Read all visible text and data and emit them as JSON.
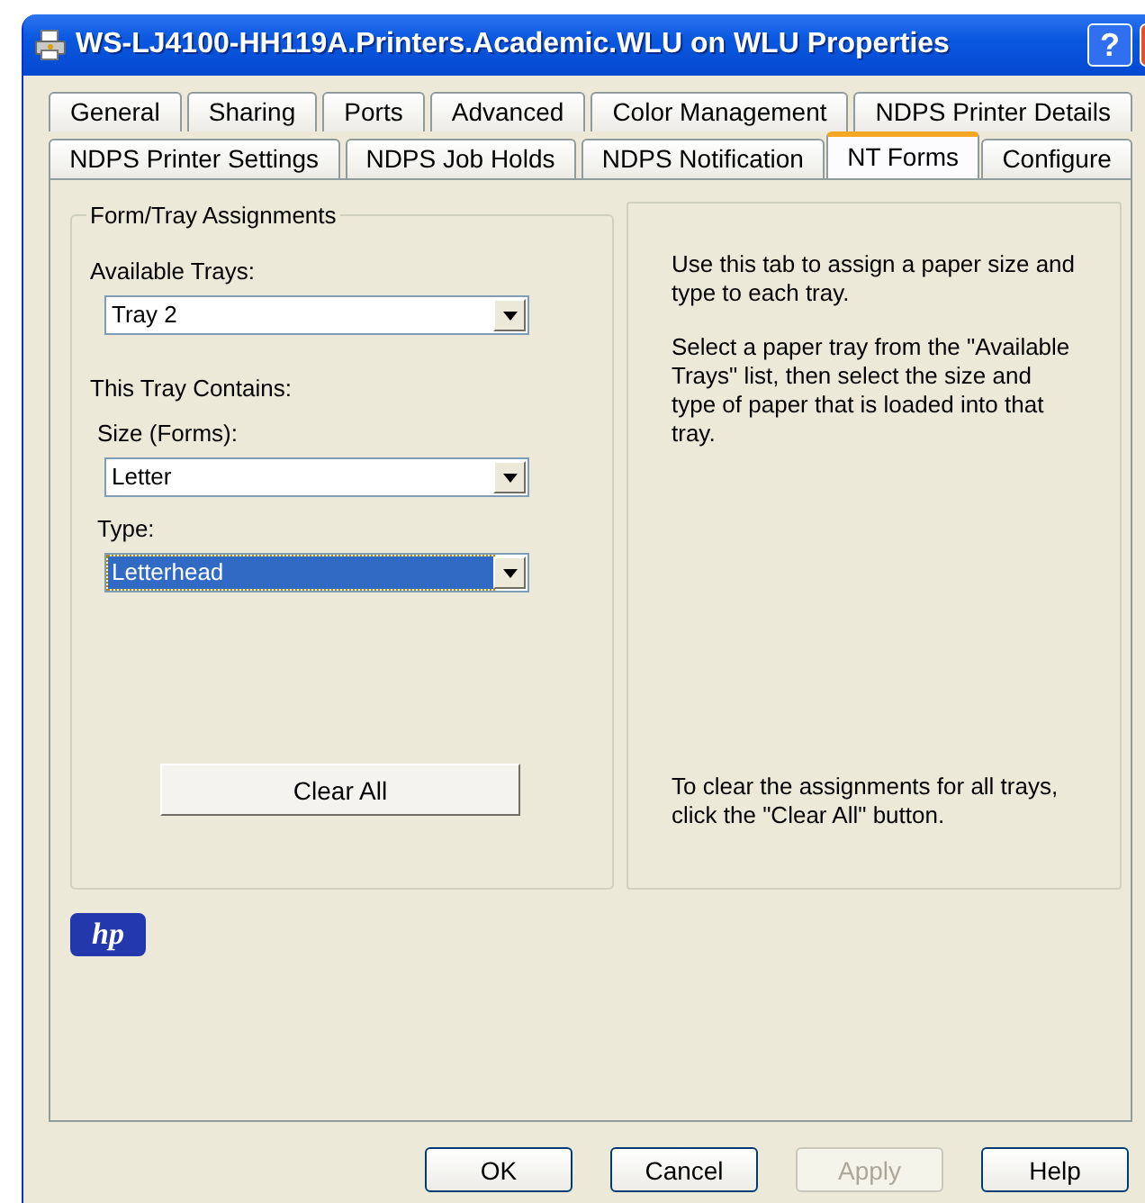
{
  "window": {
    "title": "WS-LJ4100-HH119A.Printers.Academic.WLU on WLU Properties",
    "help_button": "?"
  },
  "tab_rows": [
    {
      "tabs": [
        {
          "label": "General",
          "selected": false
        },
        {
          "label": "Sharing",
          "selected": false
        },
        {
          "label": "Ports",
          "selected": false
        },
        {
          "label": "Advanced",
          "selected": false
        },
        {
          "label": "Color Management",
          "selected": false
        },
        {
          "label": "NDPS Printer Details",
          "selected": false
        }
      ]
    },
    {
      "tabs": [
        {
          "label": "NDPS Printer Settings",
          "selected": false
        },
        {
          "label": "NDPS Job Holds",
          "selected": false
        },
        {
          "label": "NDPS Notification",
          "selected": false
        },
        {
          "label": "NT Forms",
          "selected": true
        },
        {
          "label": "Configure",
          "selected": false
        }
      ]
    }
  ],
  "group": {
    "title": "Form/Tray Assignments",
    "available_trays": {
      "label": "Available Trays:",
      "value": "Tray 2",
      "focused": false
    },
    "contains": {
      "label": "This Tray Contains:",
      "fields": [
        {
          "label": "Size (Forms):",
          "value": "Letter",
          "focused": false
        },
        {
          "label": "Type:",
          "value": "Letterhead",
          "focused": true
        }
      ]
    },
    "clear_button": "Clear All"
  },
  "help_texts": [
    "Use this tab to assign a paper size and type to each tray.",
    "Select a paper tray from the \"Available Trays\" list, then select the size and type of paper that is loaded into that tray."
  ],
  "clear_help": "To clear the assignments for all trays, click the \"Clear All\" button.",
  "logo": "hp",
  "buttons": [
    {
      "label": "OK",
      "disabled": false
    },
    {
      "label": "Cancel",
      "disabled": false
    },
    {
      "label": "Apply",
      "disabled": true
    },
    {
      "label": "Help",
      "disabled": false
    }
  ]
}
